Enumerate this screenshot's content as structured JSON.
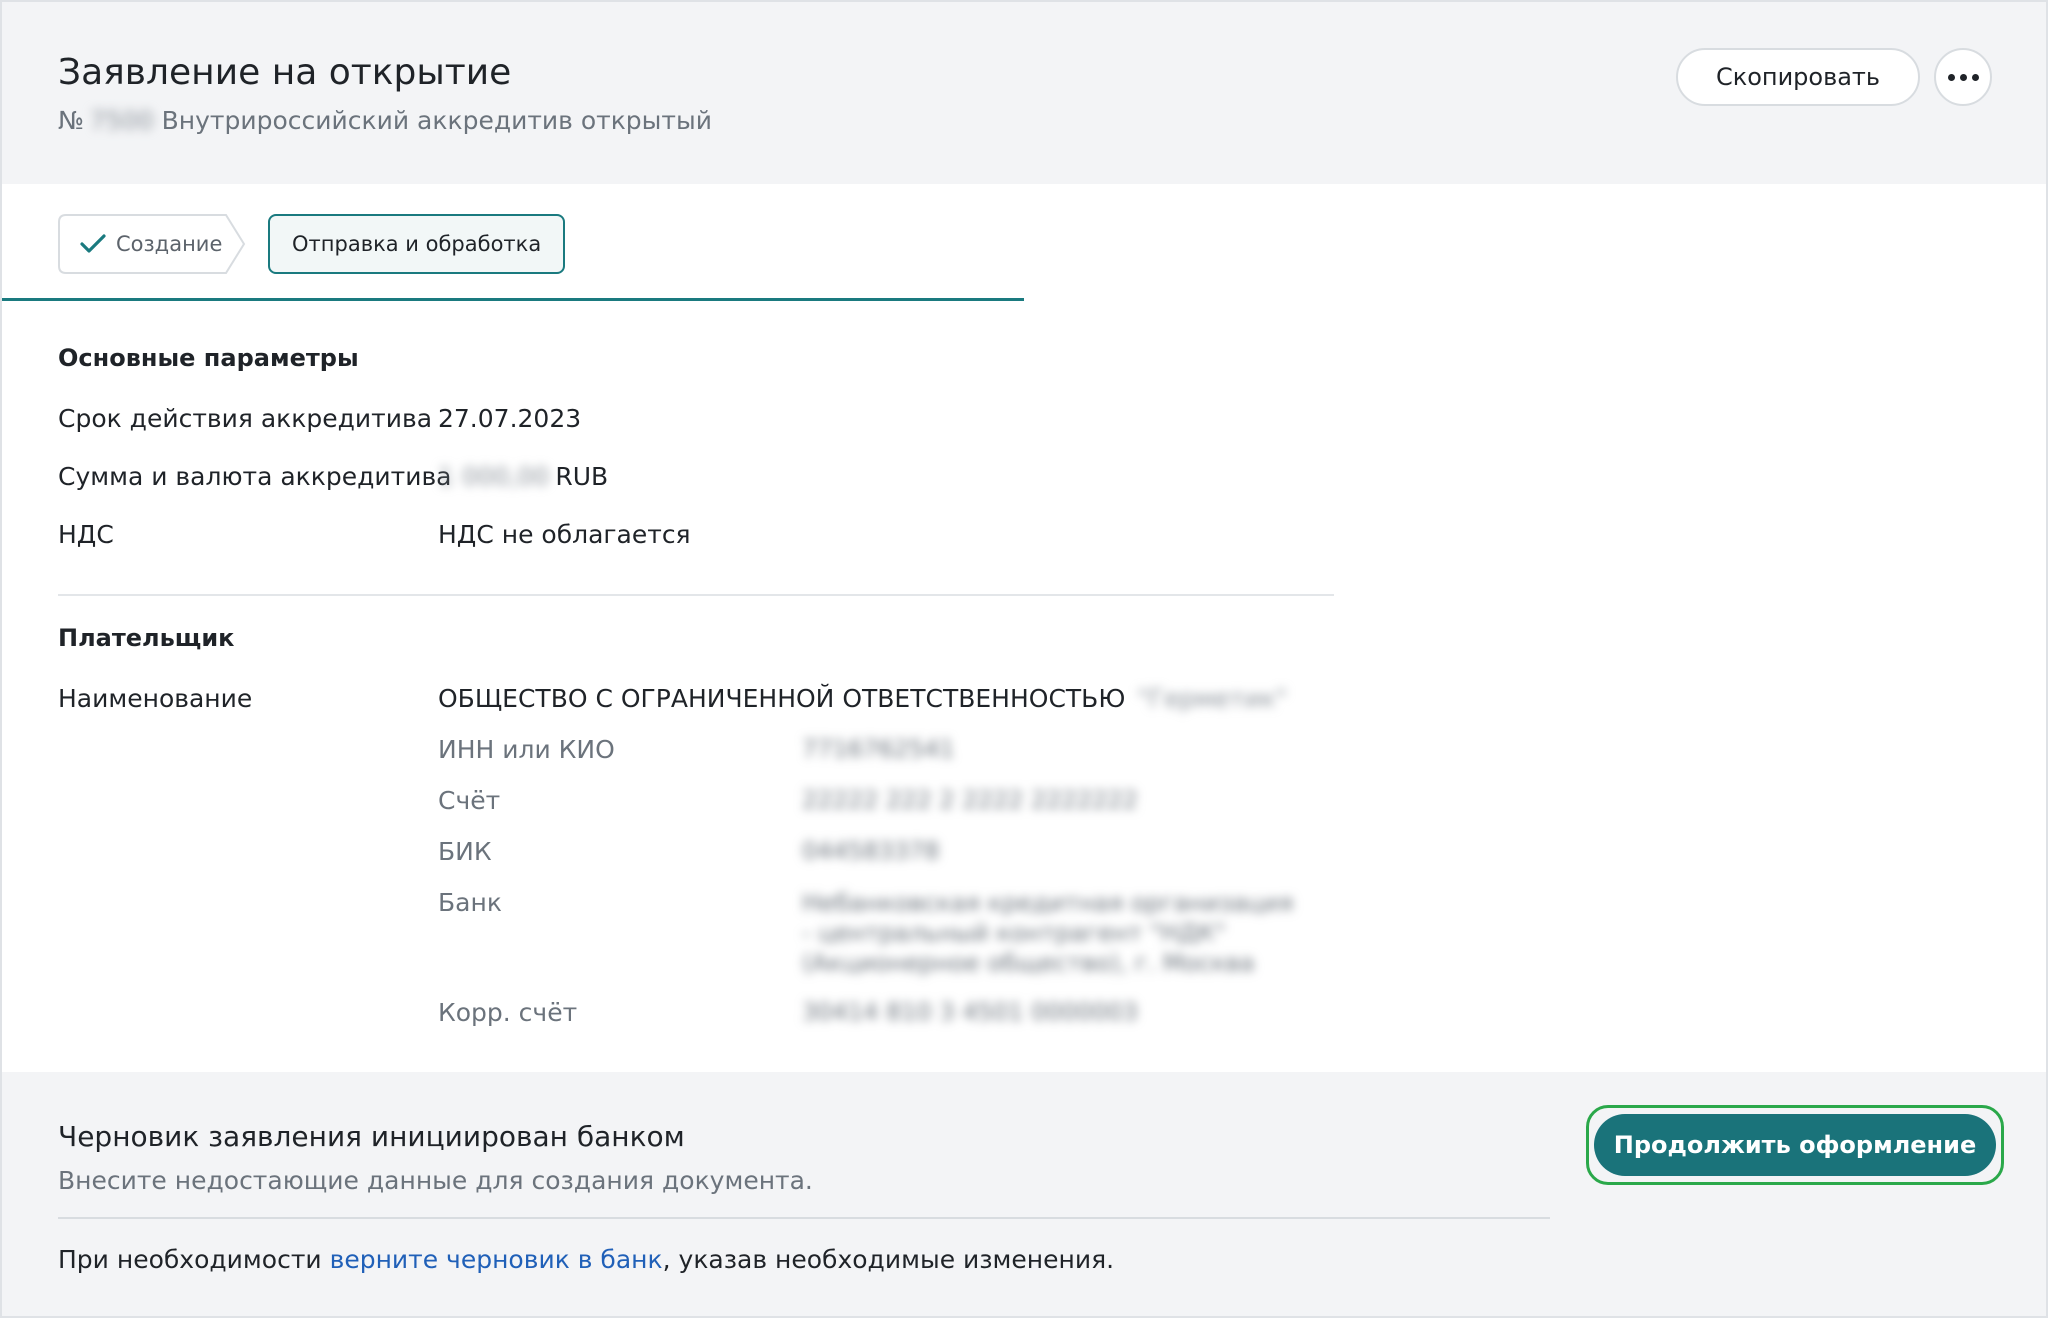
{
  "header": {
    "title": "Заявление на открытие",
    "number_prefix": "№",
    "number_value": "7500",
    "subtitle": "Внутрироссийский аккредитив открытый",
    "copy_label": "Скопировать"
  },
  "steps": [
    {
      "label": "Создание",
      "state": "done"
    },
    {
      "label": "Отправка и обработка",
      "state": "active"
    }
  ],
  "main_params": {
    "title": "Основные параметры",
    "rows": [
      {
        "label": "Срок действия аккредитива",
        "value": "27.07.2023"
      },
      {
        "label": "Сумма и валюта аккредитива",
        "amount": "1 000,00",
        "currency": "RUB"
      },
      {
        "label": "НДС",
        "value": "НДС не облагается"
      }
    ]
  },
  "payer": {
    "title": "Плательщик",
    "name_label": "Наименование",
    "name_value": "ОБЩЕСТВО С ОГРАНИЧЕННОЙ ОТВЕТСТВЕННОСТЬЮ",
    "name_hidden": "\"Герметик\"",
    "details": [
      {
        "label": "ИНН или КИО",
        "value": "7716762541"
      },
      {
        "label": "Счёт",
        "value": "22222 222 2 2222 2222222"
      },
      {
        "label": "БИК",
        "value": "044583378"
      },
      {
        "label": "Банк",
        "value": "Небанковская кредитная организация - центральный контрагент \"НДК\" (Акционерное общество), г. Москва"
      },
      {
        "label": "Корр. счёт",
        "value": "30414 810 3 4501 0000003"
      }
    ]
  },
  "footer": {
    "title": "Черновик заявления инициирован банком",
    "description": "Внесите недостающие данные для создания документа.",
    "note_before": "При необходимости ",
    "note_link": "верните черновик в банк",
    "note_after": ", указав необходимые изменения.",
    "continue_label": "Продолжить оформление"
  },
  "colors": {
    "accent": "#1a737a",
    "link": "#2060b8",
    "highlight": "#2aa84a"
  }
}
